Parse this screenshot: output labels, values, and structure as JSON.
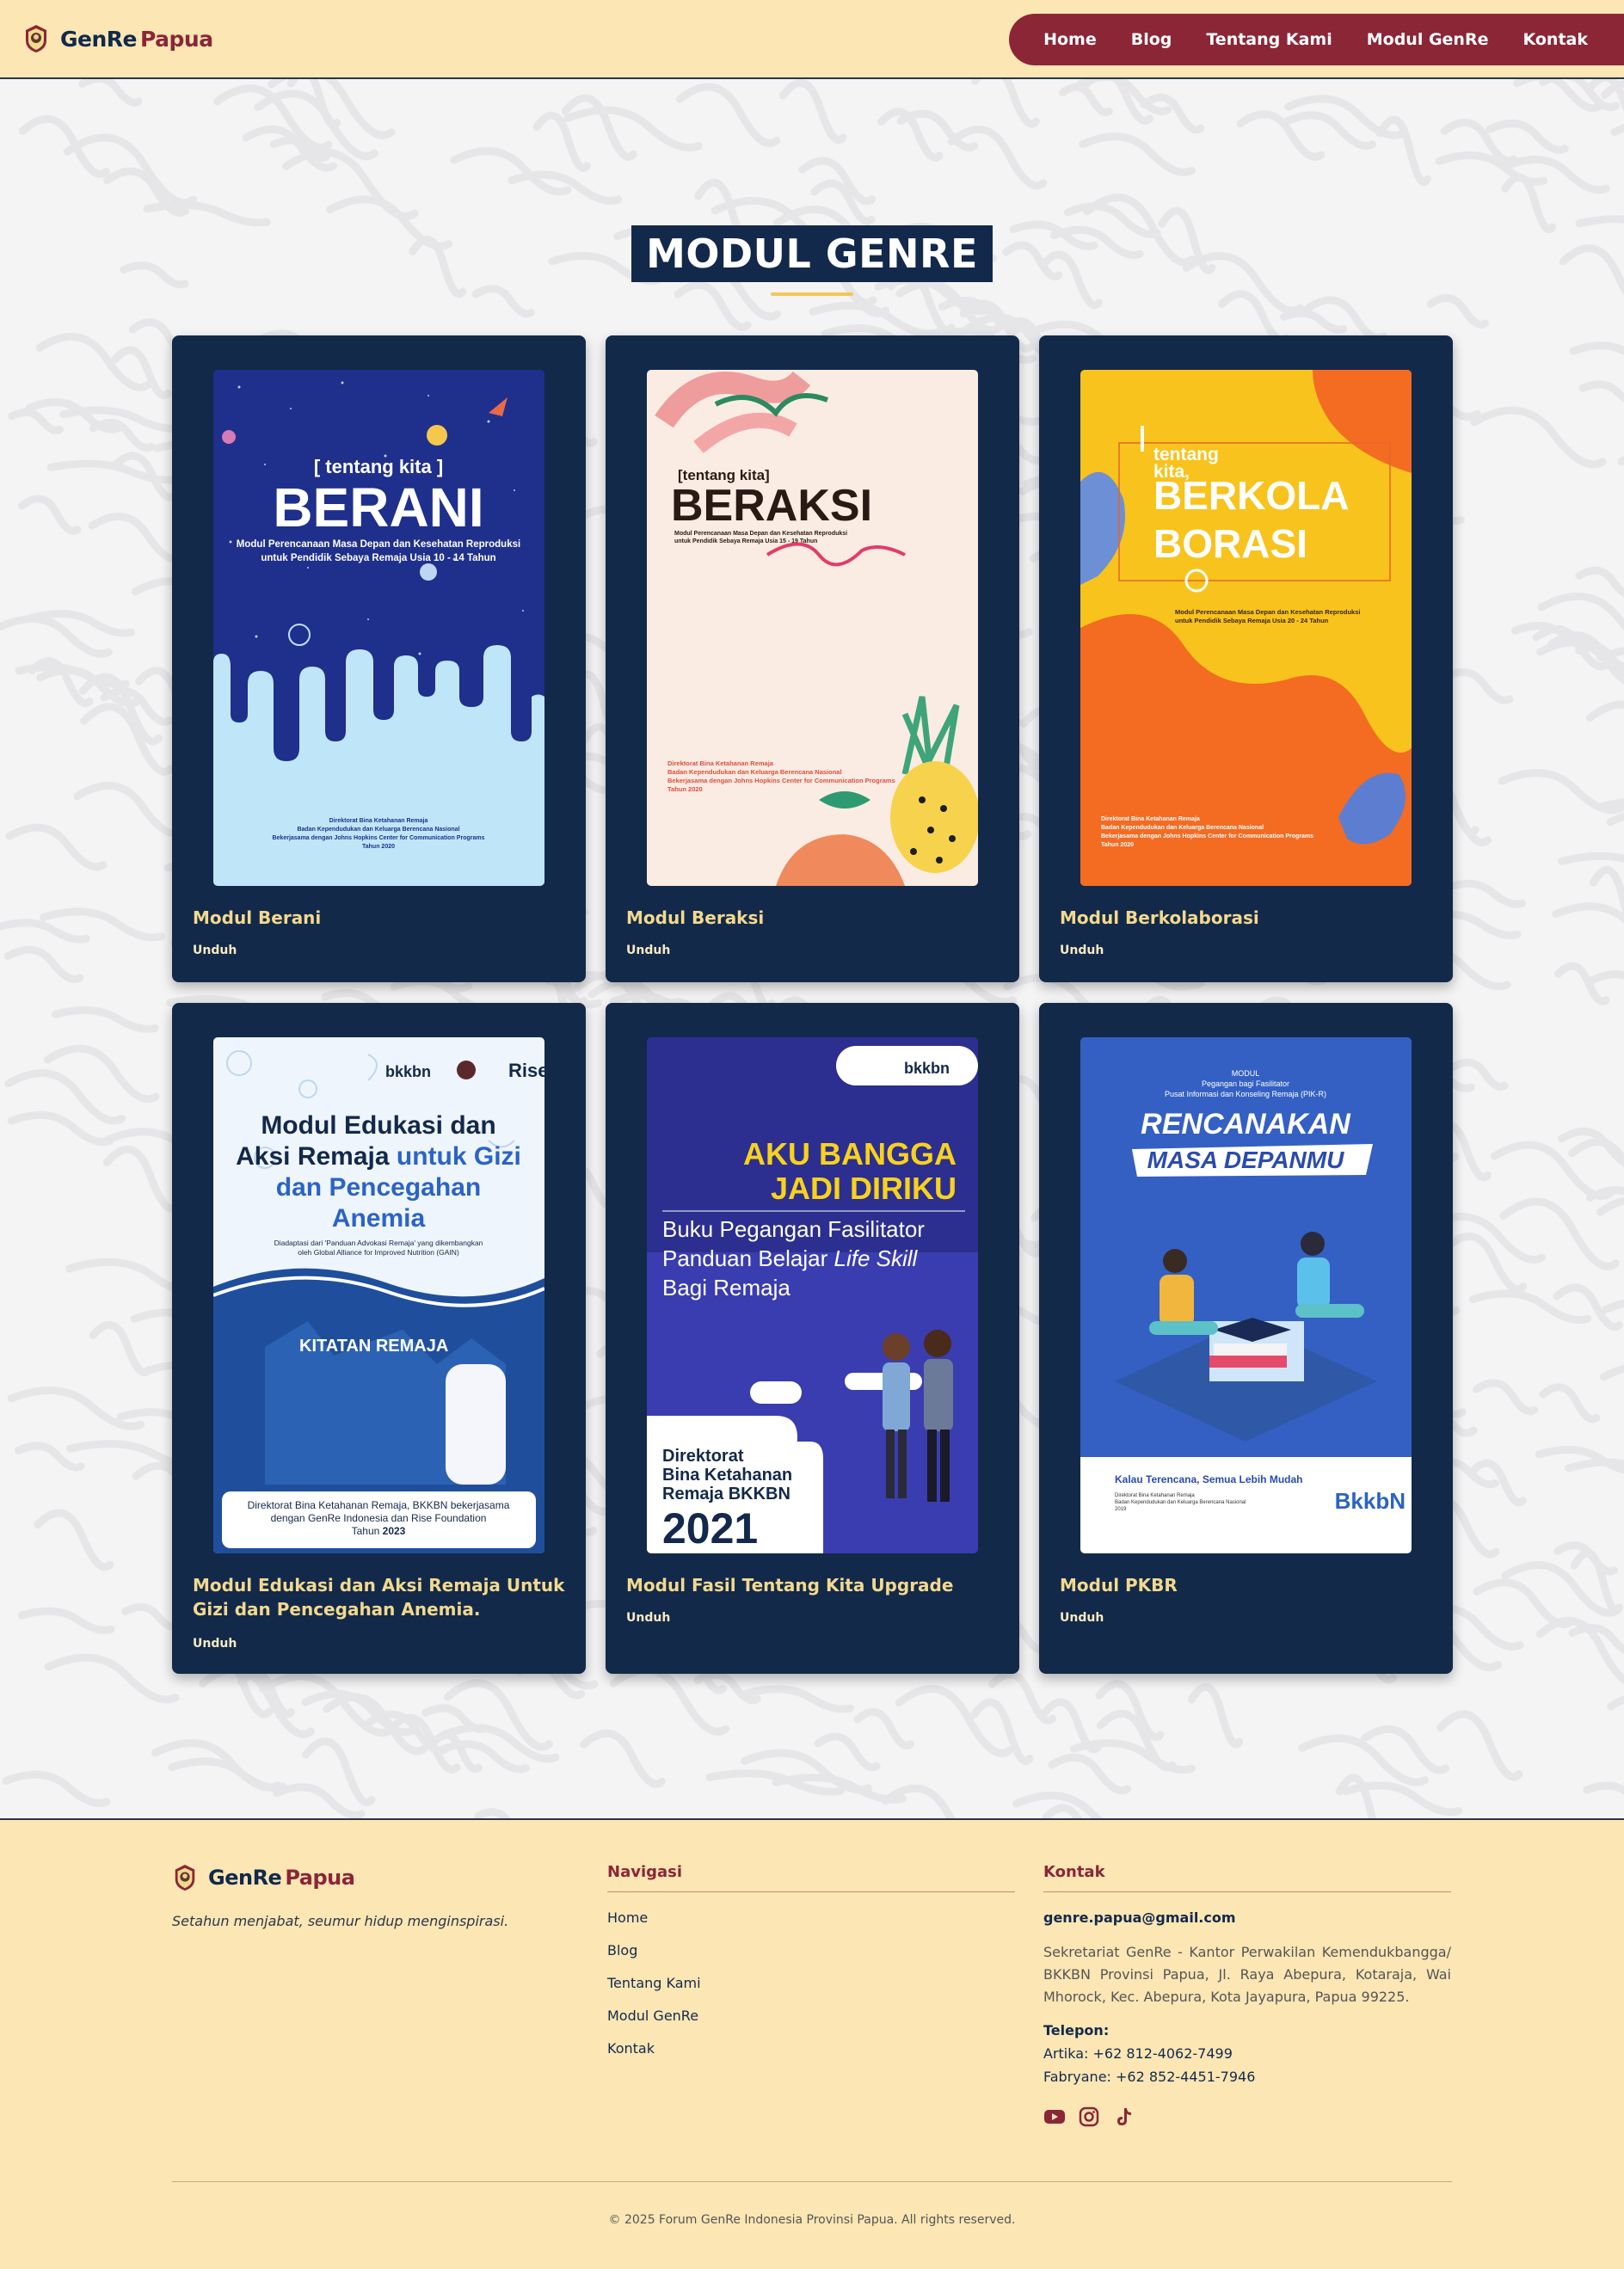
{
  "nav": {
    "brand_1": "GenRe",
    "brand_2": "Papua",
    "links": [
      "Home",
      "Blog",
      "Tentang Kami",
      "Modul GenRe",
      "Kontak"
    ]
  },
  "section_title": "MODUL GENRE",
  "modules": [
    {
      "title": "Modul Berani",
      "download": "Unduh",
      "cover": {
        "kicker": "[ tentang kita ]",
        "heading": "BERANI",
        "line1": "Modul Perencanaan Masa Depan dan Kesehatan Reproduksi",
        "line2": "untuk Pendidik Sebaya Remaja Usia 10 - 14 Tahun",
        "foot": [
          "Direktorat Bina Ketahanan Remaja",
          "Badan Kependudukan dan Keluarga Berencana Nasional",
          "Bekerjasama dengan Johns Hopkins Center for Communication Programs",
          "Tahun 2020"
        ]
      }
    },
    {
      "title": "Modul Beraksi",
      "download": "Unduh",
      "cover": {
        "kicker": "[tentang kita]",
        "heading": "BERAKSI",
        "line1": "Modul Perencanaan Masa Depan dan Kesehatan Reproduksi",
        "line2": "untuk Pendidik Sebaya Remaja Usia 15 - 19 Tahun",
        "foot": [
          "Direktorat Bina Ketahanan Remaja",
          "Badan Kependudukan dan Keluarga Berencana Nasional",
          "Bekerjasama dengan Johns Hopkins Center for Communication Programs",
          "Tahun 2020"
        ]
      }
    },
    {
      "title": "Modul Berkolaborasi",
      "download": "Unduh",
      "cover": {
        "kicker": "tentang",
        "kicker2": "kita,",
        "heading": "BERKOLA",
        "heading2": "BORASI",
        "line1": "Modul Perencanaan Masa Depan dan Kesehatan Reproduksi",
        "line2": "untuk Pendidik Sebaya Remaja Usia 20 - 24 Tahun",
        "foot": [
          "Direktorat Bina Ketahanan Remaja",
          "Badan Kependudukan dan Keluarga Berencana Nasional",
          "Bekerjasama dengan Johns Hopkins Center for Communication Programs",
          "Tahun 2020"
        ]
      }
    },
    {
      "title": "Modul Edukasi dan Aksi Remaja Untuk Gizi dan Pencegahan Anemia.",
      "download": "Unduh",
      "cover": {
        "logos": "bkkbn",
        "logo3": "Rise",
        "h1": "Modul Edukasi dan",
        "h2a": "Aksi Remaja ",
        "h2b": "untuk Gizi",
        "h3": "dan Pencegahan",
        "h4": "Anemia",
        "sub1": "Diadaptasi dari 'Panduan Advokasi Remaja' yang dikembangkan",
        "sub2": "oleh Global Alliance for Improved Nutrition (GAIN)",
        "banner": "KITATAN REMAJA",
        "foot1": "Direktorat Bina Ketahanan Remaja, BKKBN bekerjasama",
        "foot2": "dengan GenRe Indonesia dan Rise Foundation",
        "foot3a": "Tahun ",
        "foot3b": "2023"
      }
    },
    {
      "title": "Modul Fasil Tentang Kita Upgrade",
      "download": "Unduh",
      "cover": {
        "logo": "bkkbn",
        "h1": "AKU BANGGA",
        "h2": "JADI DIRIKU",
        "s1": "Buku Pegangan Fasilitator",
        "s2a": "Panduan Belajar ",
        "s2b": "Life Skill",
        "s3": "Bagi Remaja",
        "d1": "Direktorat",
        "d2": "Bina Ketahanan",
        "d3": "Remaja BKKBN",
        "year": "2021"
      }
    },
    {
      "title": "Modul PKBR",
      "download": "Unduh",
      "cover": {
        "top1": "MODUL",
        "top2": "Pegangan bagi Fasilitator",
        "top3": "Pusat Informasi dan Konseling Remaja (PIK-R)",
        "h1": "RENCANAKAN",
        "h2": "MASA DEPANMU",
        "tagline": "Kalau Terencana, Semua Lebih Mudah",
        "foot": [
          "Direktorat Bina Ketahanan Remaja",
          "Badan Kependudukan dan Keluarga Berencana Nasional",
          "2019"
        ],
        "logo": "BkkbN"
      }
    }
  ],
  "footer": {
    "brand_1": "GenRe",
    "brand_2": "Papua",
    "tagline": "Setahun menjabat, seumur hidup menginspirasi.",
    "nav_heading": "Navigasi",
    "nav_links": [
      "Home",
      "Blog",
      "Tentang Kami",
      "Modul GenRe",
      "Kontak"
    ],
    "contact_heading": "Kontak",
    "email": "genre.papua@gmail.com",
    "address": "Sekretariat GenRe - Kantor Perwakilan Kemendukbangga/ BKKBN Provinsi Papua, Jl. Raya Abepura, Kotaraja, Wai Mhorock, Kec. Abepura, Kota Jayapura, Papua 99225.",
    "phone_heading": "Telepon:",
    "phones": [
      "Artika: +62 812-4062-7499",
      "Fabryane: +62 852-4451-7946"
    ],
    "socials": [
      "youtube-icon",
      "instagram-icon",
      "tiktok-icon"
    ],
    "copyright": "© 2025 Forum GenRe Indonesia Provinsi Papua. All rights reserved."
  },
  "colors": {
    "navy": "#13294b",
    "maroon": "#8b2636",
    "cream": "#fbe6b4",
    "gold": "#f0c75a"
  }
}
